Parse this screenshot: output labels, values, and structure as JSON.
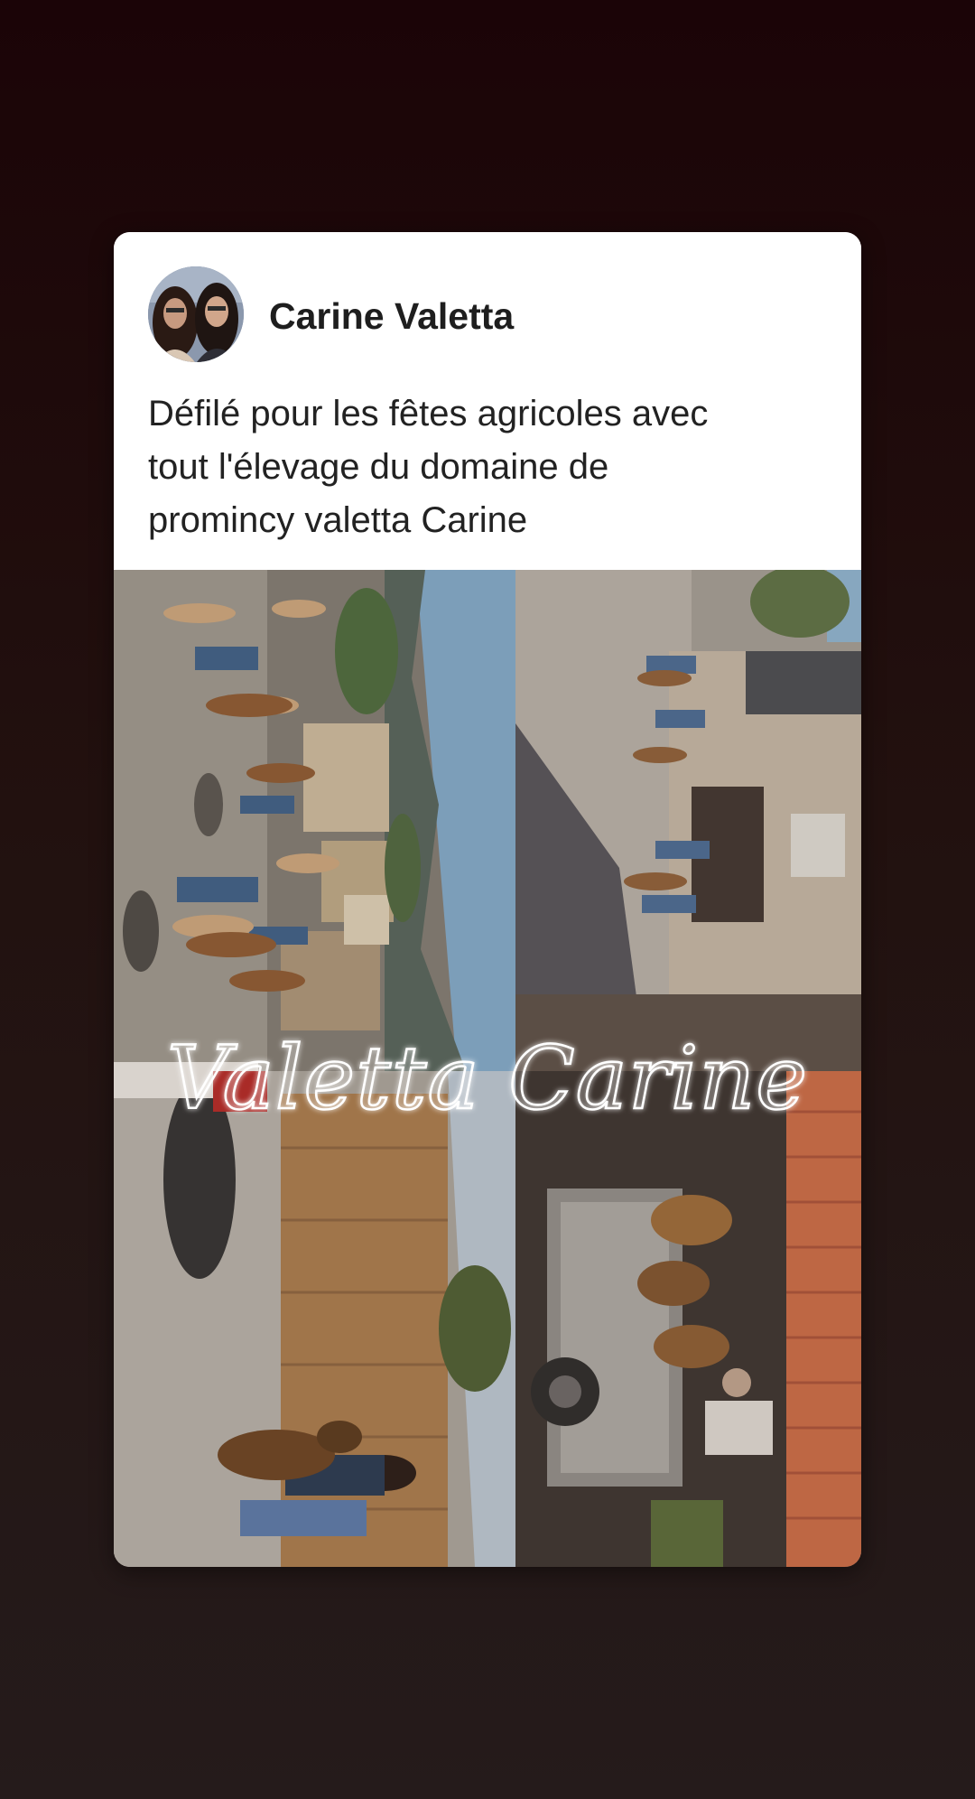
{
  "post": {
    "author_name": "Carine Valetta",
    "caption": "Défilé pour les fêtes agricoles avec\ntout l'élevage du domaine de\npromincy  valetta Carine"
  },
  "photo": {
    "watermark_text": "Valetta Carine"
  },
  "colors": {
    "background_top": "#1b0407",
    "background_bottom": "#251b1b",
    "card_bg": "#ffffff",
    "author_text": "#1e1e1e",
    "caption_text": "#222222",
    "watermark": "#ffffff"
  },
  "icons": {
    "avatar": "profile-photo-two-women"
  }
}
